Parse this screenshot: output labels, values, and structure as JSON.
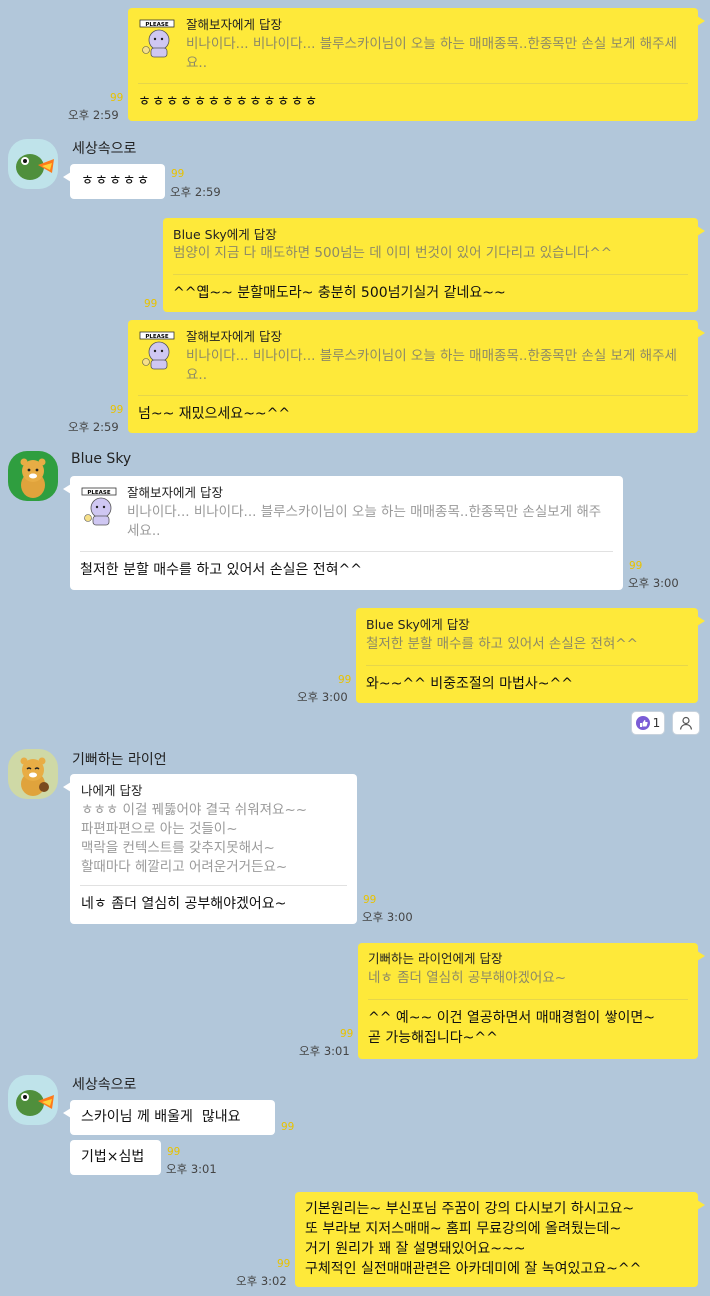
{
  "colors": {
    "background": "#b2c7da",
    "my_bubble": "#fee93a",
    "their_bubble": "#ffffff",
    "unread": "#e8c200",
    "like": "#7b5cd6"
  },
  "messages": {
    "m1": {
      "reply_to": "잘해보자에게 답장",
      "quote": "비나이다... 비나이다... 블루스카이님이  오늘 하는 매매종목..한종목만 손실 보게 해주세요..",
      "text": "ㅎㅎㅎㅎㅎㅎㅎㅎㅎㅎㅎㅎㅎ",
      "unread": "99",
      "time": "오후 2:59"
    },
    "m2": {
      "sender": "세상속으로",
      "text": "ㅎㅎㅎㅎㅎ",
      "unread": "99",
      "time": "오후 2:59"
    },
    "m3": {
      "reply_to": "Blue Sky에게 답장",
      "quote": "범양이 지금 다 매도하면 500넘는 데 이미 번것이 있어 기다리고 있습니다^^",
      "text": "^^옙~~ 분할매도라~ 충분히 500넘기실거 같네요~~",
      "unread": "99"
    },
    "m4": {
      "reply_to": "잘해보자에게 답장",
      "quote": "비나이다... 비나이다... 블루스카이님이  오늘 하는 매매종목..한종목만 손실 보게 해주세요..",
      "text": "넘~~ 재밌으세요~~^^",
      "unread": "99",
      "time": "오후 2:59"
    },
    "m5": {
      "sender": "Blue Sky",
      "reply_to": "잘해보자에게 답장",
      "quote": "비나이다... 비나이다... 블루스카이님이  오늘 하는 매매종목..한종목만 손실보게 해주세요..",
      "text": "철저한 분할 매수를 하고 있어서 손실은 전혀^^",
      "unread": "99",
      "time": "오후 3:00"
    },
    "m6": {
      "reply_to": "Blue Sky에게 답장",
      "quote": "철저한 분할 매수를 하고 있어서 손실은 전혀^^",
      "text": "와~~^^ 비중조절의 마법사~^^",
      "unread": "99",
      "time": "오후 3:00",
      "like_count": "1"
    },
    "m7": {
      "sender": "기뻐하는 라이언",
      "reply_to": "나에게 답장",
      "quote": "ㅎㅎㅎ 이걸 꿰뚫어야 결국 쉬워져요~~\n파편파편으로 아는 것들이~\n맥락을 컨텍스트를 갖추지못해서~\n할때마다 헤깔리고 어려운거거든요~",
      "text": "네ㅎ 좀더 열심히 공부해야겠어요~",
      "unread": "99",
      "time": "오후 3:00"
    },
    "m8": {
      "reply_to": "기뻐하는 라이언에게 답장",
      "quote": "네ㅎ 좀더 열심히 공부해야겠어요~",
      "text": "^^ 예~~ 이건 열공하면서 매매경험이 쌓이면~\n곧 가능해집니다~^^",
      "unread": "99",
      "time": "오후 3:01"
    },
    "m9": {
      "sender": "세상속으로",
      "text": "스카이님 께 배울게  많내요",
      "unread": "99"
    },
    "m10": {
      "text": "기법×심법",
      "unread": "99",
      "time": "오후 3:01"
    },
    "m11": {
      "text": "기본원리는~ 부신포님 주꿈이 강의 다시보기 하시고요~\n또 부라보 지저스매매~ 홈피 무료강의에 올려뒀는데~\n거기 원리가 꽤 잘 설명돼있어요~~~\n구체적인 실전매매관련은 아카데미에 잘 녹여있고요~^^",
      "unread": "99",
      "time": "오후 3:02"
    }
  },
  "icons": {
    "emoticon": "please-emoticon",
    "like": "thumbs-up-icon",
    "profile": "person-icon"
  }
}
